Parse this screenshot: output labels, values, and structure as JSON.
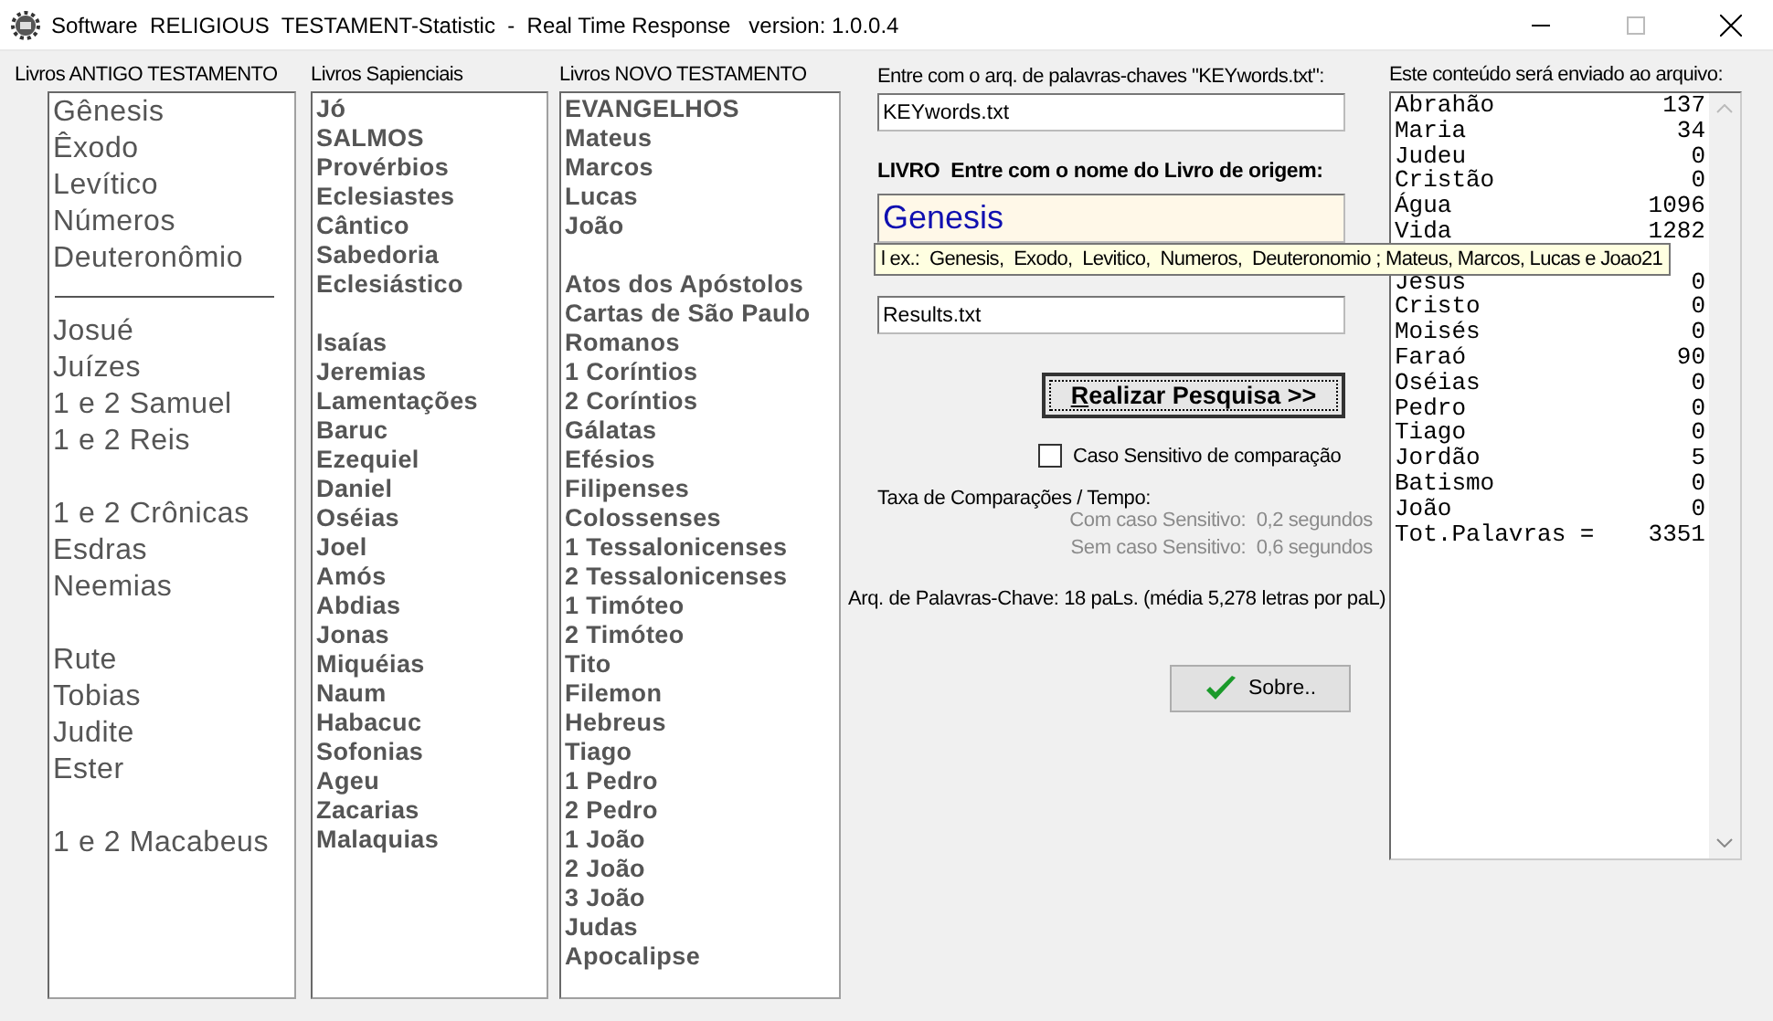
{
  "window": {
    "title": "Software  RELIGIOUS  TESTAMENT-Statistic  -  Real Time Response   version: 1.0.0.4"
  },
  "book_lists": [
    {
      "label": "Livros ANTIGO TESTAMENTO",
      "items": [
        {
          "kind": "item",
          "text": "Gênesis"
        },
        {
          "kind": "item",
          "text": "Êxodo"
        },
        {
          "kind": "item",
          "text": "Levítico"
        },
        {
          "kind": "item",
          "text": "Números"
        },
        {
          "kind": "item",
          "text": "Deuteronômio"
        },
        {
          "kind": "separator"
        },
        {
          "kind": "item",
          "text": "Josué"
        },
        {
          "kind": "item",
          "text": "Juízes"
        },
        {
          "kind": "item",
          "text": "1 e 2 Samuel"
        },
        {
          "kind": "item",
          "text": "1 e 2 Reis"
        },
        {
          "kind": "gap"
        },
        {
          "kind": "item",
          "text": "1 e 2 Crônicas"
        },
        {
          "kind": "item",
          "text": "Esdras"
        },
        {
          "kind": "item",
          "text": "Neemias"
        },
        {
          "kind": "gap"
        },
        {
          "kind": "item",
          "text": "Rute"
        },
        {
          "kind": "item",
          "text": "Tobias"
        },
        {
          "kind": "item",
          "text": "Judite"
        },
        {
          "kind": "item",
          "text": "Ester"
        },
        {
          "kind": "gap"
        },
        {
          "kind": "item",
          "text": "1 e 2 Macabeus"
        }
      ]
    },
    {
      "label": "Livros Sapienciais",
      "items": [
        {
          "kind": "item",
          "text": "Jó"
        },
        {
          "kind": "item",
          "text": "SALMOS"
        },
        {
          "kind": "item",
          "text": "Provérbios"
        },
        {
          "kind": "item",
          "text": "Eclesiastes"
        },
        {
          "kind": "item",
          "text": "Cântico"
        },
        {
          "kind": "item",
          "text": "Sabedoria"
        },
        {
          "kind": "item",
          "text": "Eclesiástico"
        },
        {
          "kind": "gap"
        },
        {
          "kind": "item",
          "text": "Isaías"
        },
        {
          "kind": "item",
          "text": "Jeremias"
        },
        {
          "kind": "item",
          "text": "Lamentações"
        },
        {
          "kind": "item",
          "text": "Baruc"
        },
        {
          "kind": "item",
          "text": "Ezequiel"
        },
        {
          "kind": "item",
          "text": "Daniel"
        },
        {
          "kind": "item",
          "text": "Oséias"
        },
        {
          "kind": "item",
          "text": "Joel"
        },
        {
          "kind": "item",
          "text": "Amós"
        },
        {
          "kind": "item",
          "text": "Abdias"
        },
        {
          "kind": "item",
          "text": "Jonas"
        },
        {
          "kind": "item",
          "text": "Miquéias"
        },
        {
          "kind": "item",
          "text": "Naum"
        },
        {
          "kind": "item",
          "text": "Habacuc"
        },
        {
          "kind": "item",
          "text": "Sofonias"
        },
        {
          "kind": "item",
          "text": "Ageu"
        },
        {
          "kind": "item",
          "text": "Zacarias"
        },
        {
          "kind": "item",
          "text": "Malaquias"
        }
      ]
    },
    {
      "label": "Livros NOVO TESTAMENTO",
      "items": [
        {
          "kind": "item",
          "text": "EVANGELHOS"
        },
        {
          "kind": "item",
          "text": "Mateus"
        },
        {
          "kind": "item",
          "text": "Marcos"
        },
        {
          "kind": "item",
          "text": "Lucas"
        },
        {
          "kind": "item",
          "text": "João"
        },
        {
          "kind": "gap"
        },
        {
          "kind": "item",
          "text": "Atos dos Apóstolos"
        },
        {
          "kind": "item",
          "text": "Cartas de São Paulo"
        },
        {
          "kind": "item",
          "text": "Romanos"
        },
        {
          "kind": "item",
          "text": "1 Coríntios"
        },
        {
          "kind": "item",
          "text": "2 Coríntios"
        },
        {
          "kind": "item",
          "text": "Gálatas"
        },
        {
          "kind": "item",
          "text": "Efésios"
        },
        {
          "kind": "item",
          "text": "Filipenses"
        },
        {
          "kind": "item",
          "text": "Colossenses"
        },
        {
          "kind": "item",
          "text": "1 Tessalonicenses"
        },
        {
          "kind": "item",
          "text": "2 Tessalonicenses"
        },
        {
          "kind": "item",
          "text": "1 Timóteo"
        },
        {
          "kind": "item",
          "text": "2 Timóteo"
        },
        {
          "kind": "item",
          "text": "Tito"
        },
        {
          "kind": "item",
          "text": "Filemon"
        },
        {
          "kind": "item",
          "text": "Hebreus"
        },
        {
          "kind": "item",
          "text": "Tiago"
        },
        {
          "kind": "item",
          "text": "1 Pedro"
        },
        {
          "kind": "item",
          "text": "2 Pedro"
        },
        {
          "kind": "item",
          "text": "1 João"
        },
        {
          "kind": "item",
          "text": "2 João"
        },
        {
          "kind": "item",
          "text": "3 João"
        },
        {
          "kind": "item",
          "text": "Judas"
        },
        {
          "kind": "item",
          "text": "Apocalipse"
        }
      ]
    }
  ],
  "keywords_file": {
    "label": "Entre com o arq. de palavras-chaves \"KEYwords.txt\":",
    "value": "KEYwords.txt"
  },
  "book_field": {
    "label_bold": "LIVRO",
    "label": "Entre com o nome do Livro de origem:",
    "value": "Genesis"
  },
  "results_file": {
    "value": "Results.txt"
  },
  "tooltip": "l ex.:  Genesis,  Exodo,  Levitico,  Numeros,  Deuteronomio ; Mateus, Marcos, Lucas e Joao21",
  "search_button": {
    "accel": "R",
    "label": "ealizar Pesquisa >>"
  },
  "case_sensitive": {
    "label": "Caso Sensitivo de comparação",
    "checked": false
  },
  "timing": {
    "title": "Taxa de Comparações / Tempo:",
    "lines": [
      "Com caso Sensitivo:  0,2 segundos",
      "Sem caso Sensitivo:  0,6 segundos"
    ]
  },
  "keyword_stats": "Arq. de Palavras-Chave: 18 paLs. (média 5,278 letras por paL)",
  "about_button": "Sobre..",
  "output": {
    "label": "Este conteúdo será enviado ao arquivo:",
    "rows": [
      {
        "word": "Abrahão",
        "count": "137"
      },
      {
        "word": "Maria",
        "count": "34"
      },
      {
        "word": "Judeu",
        "count": "0"
      },
      {
        "word": "Cristão",
        "count": "0"
      },
      {
        "word": "Água",
        "count": "1096"
      },
      {
        "word": "Vida",
        "count": "1282"
      }
    ],
    "rows_below_tooltip": [
      {
        "word": "Jesus",
        "count": "0"
      },
      {
        "word": "Cristo",
        "count": "0"
      },
      {
        "word": "Moisés",
        "count": "0"
      },
      {
        "word": "Faraó",
        "count": "90"
      },
      {
        "word": "Oséias",
        "count": "0"
      },
      {
        "word": "Pedro",
        "count": "0"
      },
      {
        "word": "Tiago",
        "count": "0"
      },
      {
        "word": "Jordão",
        "count": "5"
      },
      {
        "word": "Batismo",
        "count": "0"
      },
      {
        "word": "João",
        "count": "0"
      },
      {
        "word": "Tot.Palavras =",
        "count": "3351"
      }
    ]
  }
}
